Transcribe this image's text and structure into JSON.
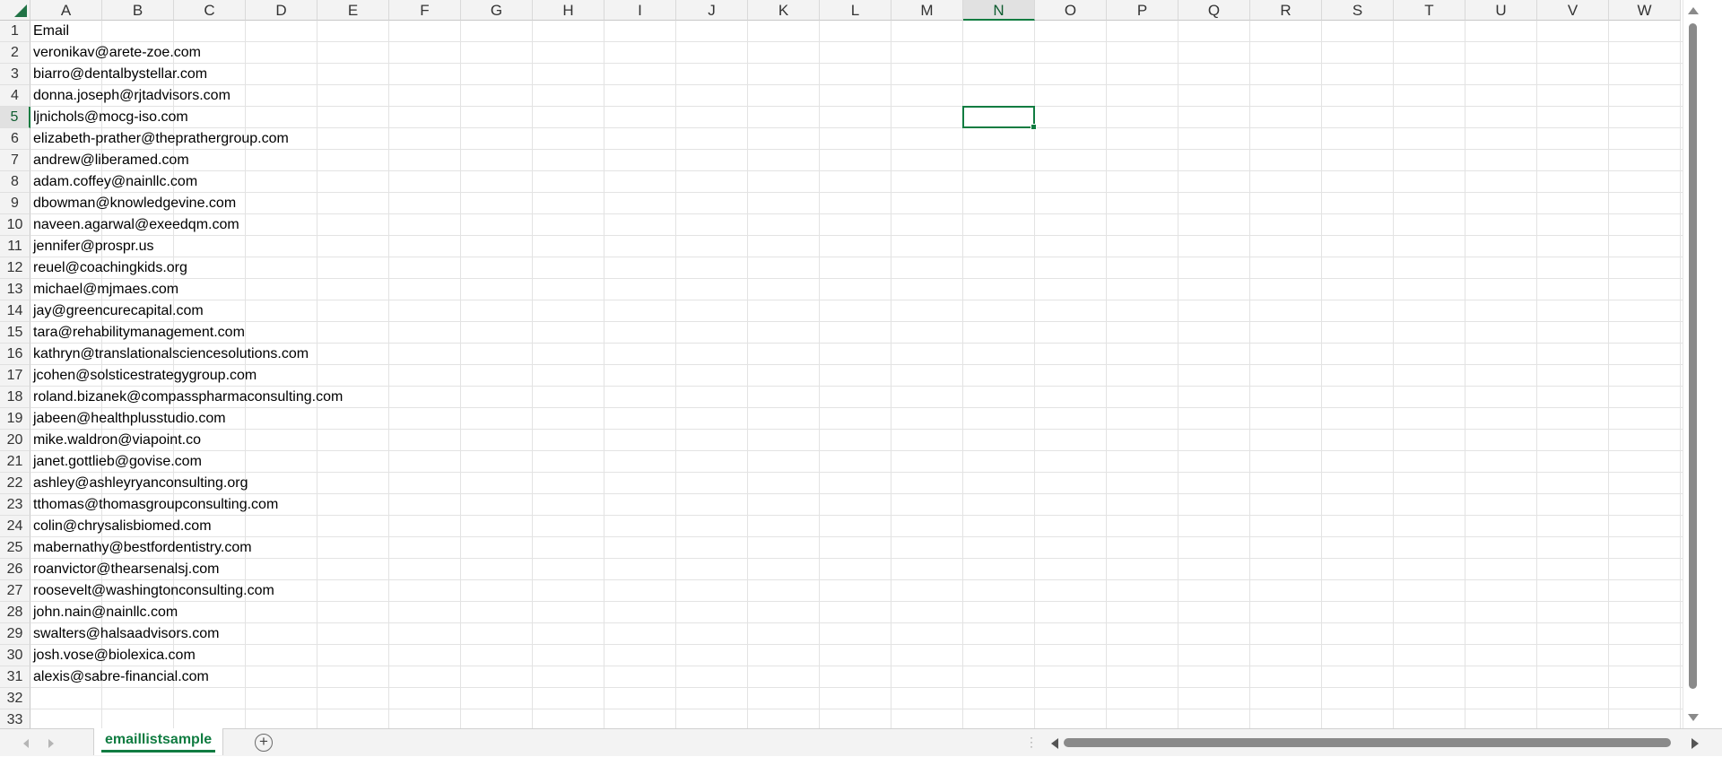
{
  "sheet": {
    "columns": [
      "A",
      "B",
      "C",
      "D",
      "E",
      "F",
      "G",
      "H",
      "I",
      "J",
      "K",
      "L",
      "M",
      "N",
      "O",
      "P",
      "Q",
      "R",
      "S",
      "T",
      "U",
      "V",
      "W"
    ],
    "rows": [
      "1",
      "2",
      "3",
      "4",
      "5",
      "6",
      "7",
      "8",
      "9",
      "10",
      "11",
      "12",
      "13",
      "14",
      "15",
      "16",
      "17",
      "18",
      "19",
      "20",
      "21",
      "22",
      "23",
      "24",
      "25",
      "26",
      "27",
      "28",
      "29",
      "30",
      "31",
      "32",
      "33"
    ],
    "active_column": "N",
    "active_row": "5",
    "cells_col_a": [
      "Email",
      "veronikav@arete-zoe.com",
      "biarro@dentalbystellar.com",
      "donna.joseph@rjtadvisors.com",
      "ljnichols@mocg-iso.com",
      "elizabeth-prather@theprathergroup.com",
      "andrew@liberamed.com",
      "adam.coffey@nainllc.com",
      "dbowman@knowledgevine.com",
      "naveen.agarwal@exeedqm.com",
      "jennifer@prospr.us",
      "reuel@coachingkids.org",
      "michael@mjmaes.com",
      "jay@greencurecapital.com",
      "tara@rehabilitymanagement.com",
      "kathryn@translationalsciencesolutions.com",
      "jcohen@solsticestrategygroup.com",
      "roland.bizanek@compasspharmaconsulting.com",
      "jabeen@healthplusstudio.com",
      "mike.waldron@viapoint.co",
      "janet.gottlieb@govise.com",
      "ashley@ashleyryanconsulting.org",
      "tthomas@thomasgroupconsulting.com",
      "colin@chrysalisbiomed.com",
      "mabernathy@bestfordentistry.com",
      "roanvictor@thearsenalsj.com",
      "roosevelt@washingtonconsulting.com",
      "john.nain@nainllc.com",
      "swalters@halsaadvisors.com",
      "josh.vose@biolexica.com",
      "alexis@sabre-financial.com",
      "",
      ""
    ]
  },
  "sheet_tabs": {
    "active_tab": "emaillistsample",
    "add_sheet_label": "+"
  },
  "colors": {
    "accent": "#107c41",
    "header_bg": "#f3f3f3",
    "gridline": "#e3e3e3"
  },
  "icons": {
    "corner": "select-all-triangle-icon",
    "nav_prev": "chevron-left-icon",
    "nav_next": "chevron-right-icon",
    "add_sheet": "plus-circle-icon"
  }
}
